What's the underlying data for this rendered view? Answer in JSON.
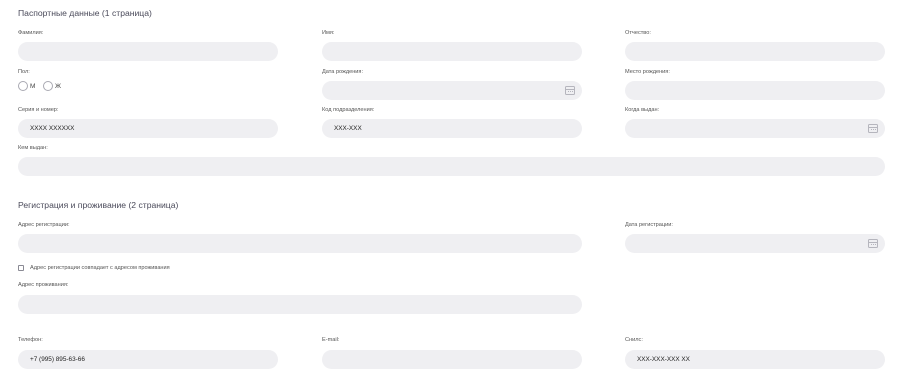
{
  "passport": {
    "title": "Паспортные данные (1 страница)",
    "surname": {
      "label": "Фамилия:",
      "value": ""
    },
    "name": {
      "label": "Имя:",
      "value": ""
    },
    "patronymic": {
      "label": "Отчество:",
      "value": ""
    },
    "gender": {
      "label": "Пол:",
      "options": [
        "М",
        "Ж"
      ]
    },
    "birth_date": {
      "label": "Дата рождения:",
      "value": ""
    },
    "birth_place": {
      "label": "Место рождения:",
      "value": ""
    },
    "series_number": {
      "label": "Серия и номер:",
      "value": "XXXX XXXXXX"
    },
    "division_code": {
      "label": "Код подразделения:",
      "value": "XXX-XXX"
    },
    "issue_date": {
      "label": "Когда выдан:",
      "value": ""
    },
    "issued_by": {
      "label": "Кем выдан:",
      "value": ""
    }
  },
  "registration": {
    "title": "Регистрация и проживание (2 страница)",
    "address": {
      "label": "Адрес регистрации:",
      "value": ""
    },
    "date": {
      "label": "Дата регистрации:",
      "value": ""
    },
    "same_address_checkbox": "Адрес регистрации совпадает с адресом проживания",
    "residence": {
      "label": "Адрес проживания:",
      "value": ""
    }
  },
  "contacts": {
    "phone": {
      "label": "Телефон:",
      "value": "+7 (995) 895-63-66"
    },
    "email": {
      "label": "E-mail:",
      "value": ""
    },
    "snils": {
      "label": "Снилс:",
      "value": "XXX-XXX-XXX XX"
    }
  },
  "icons": {
    "date_picker": "calendar-icon"
  }
}
